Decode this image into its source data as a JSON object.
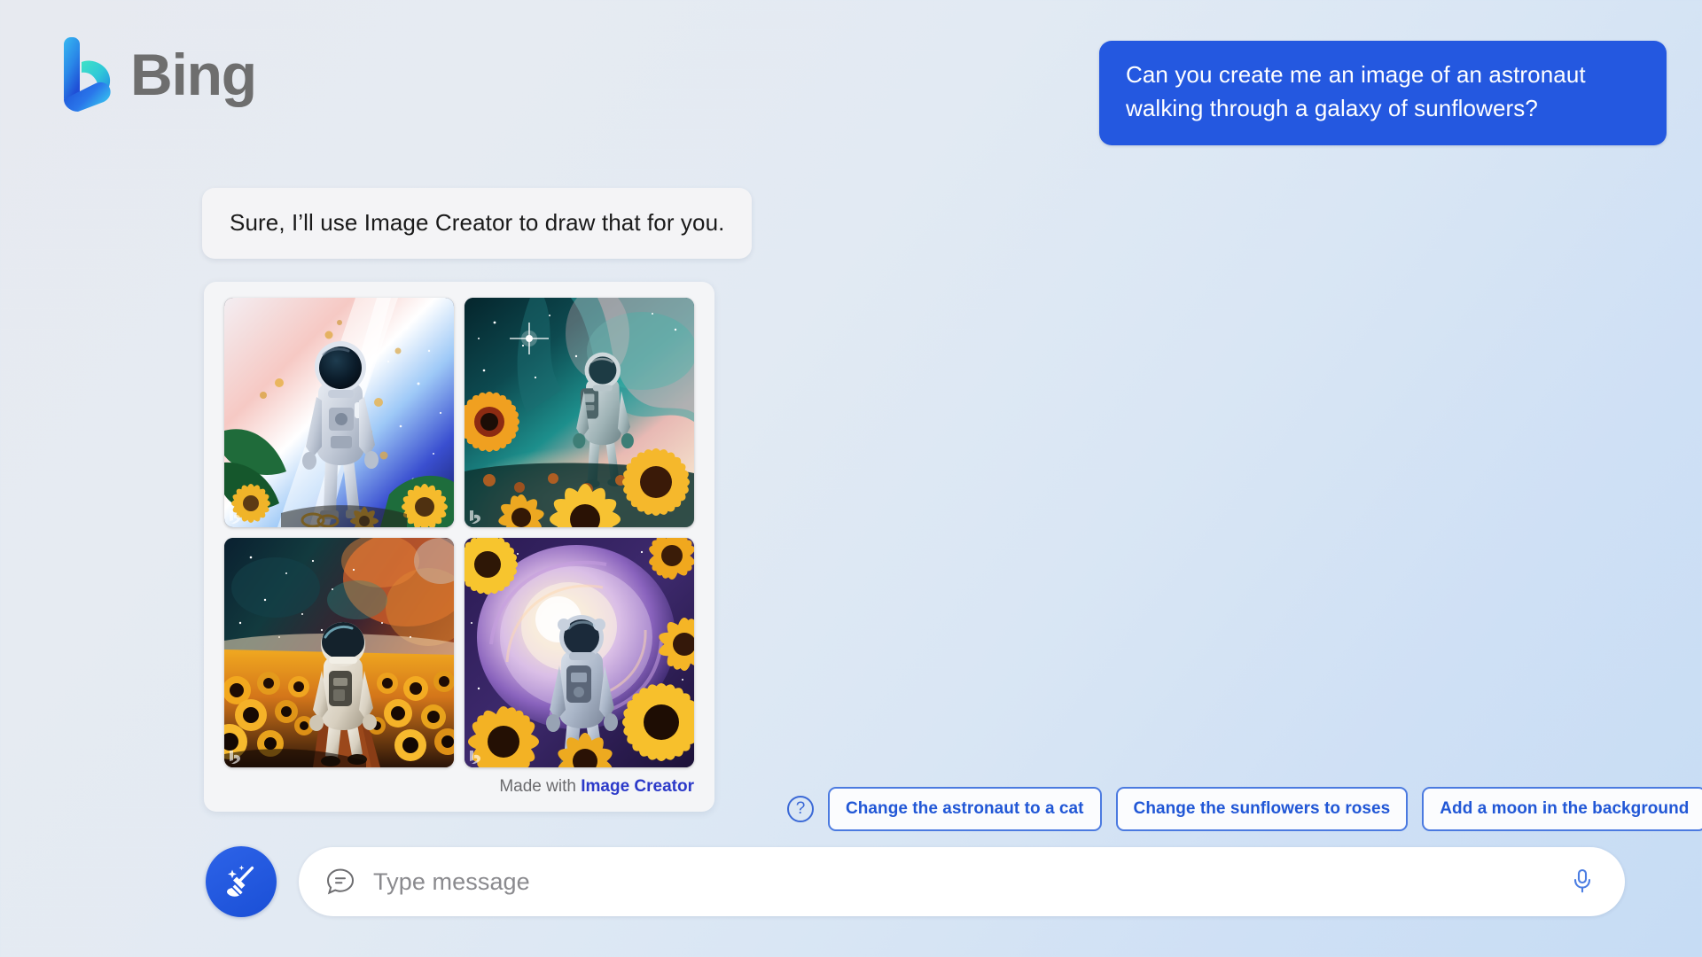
{
  "brand": {
    "name": "Bing",
    "logo_icon": "bing-logo-icon",
    "gradient_start": "#35b5f0",
    "gradient_end": "#1b4dd4",
    "teal": "#3ee0c8"
  },
  "conversation": {
    "user_message": {
      "text": "Can you create me an image of an astronaut walking through a galaxy of sunflowers?",
      "bubble_color": "#2458e0",
      "text_color": "#ffffff"
    },
    "assistant_message": {
      "text": "Sure, I’ll use Image Creator to draw that for you.",
      "bubble_color": "#f4f4f6",
      "text_color": "#1a1a1a"
    }
  },
  "image_card": {
    "images": [
      {
        "alt": "Astronaut in white suit facing viewer amid sunflowers with pink and blue galaxy",
        "watermark": "bing-watermark-icon"
      },
      {
        "alt": "Astronaut walking away through teal and pink nebula with large sunflowers",
        "watermark": "bing-watermark-icon"
      },
      {
        "alt": "Astronaut walking down a path in a sunflower field under an orange nebula",
        "watermark": "bing-watermark-icon"
      },
      {
        "alt": "Astronaut walking toward a glowing purple spiral galaxy framed by sunflowers",
        "watermark": "bing-watermark-icon"
      }
    ],
    "footer": {
      "prefix": "Made with",
      "link_label": "Image Creator",
      "prefix_color": "#6b6b6e",
      "link_color": "#2c3ac9"
    }
  },
  "suggestions": {
    "help_icon": "question-mark-icon",
    "help_label": "?",
    "chips": [
      {
        "label": "Change the astronaut to a cat"
      },
      {
        "label": "Change the sunflowers to roses"
      },
      {
        "label": "Add a moon in the background"
      }
    ],
    "border_color": "#4b7ae0",
    "text_color": "#2157d6"
  },
  "composer": {
    "new_topic": {
      "icon": "broom-sparkle-icon",
      "label": "New topic",
      "color": "#1f55dd"
    },
    "message_icon": "chat-bubble-lines-icon",
    "input": {
      "value": "",
      "placeholder": "Type message"
    },
    "mic": {
      "icon": "microphone-icon",
      "color": "#4b7de2"
    }
  },
  "background": {
    "top_left": "#e7eaf0",
    "bottom_right": "#c6dcf4"
  }
}
